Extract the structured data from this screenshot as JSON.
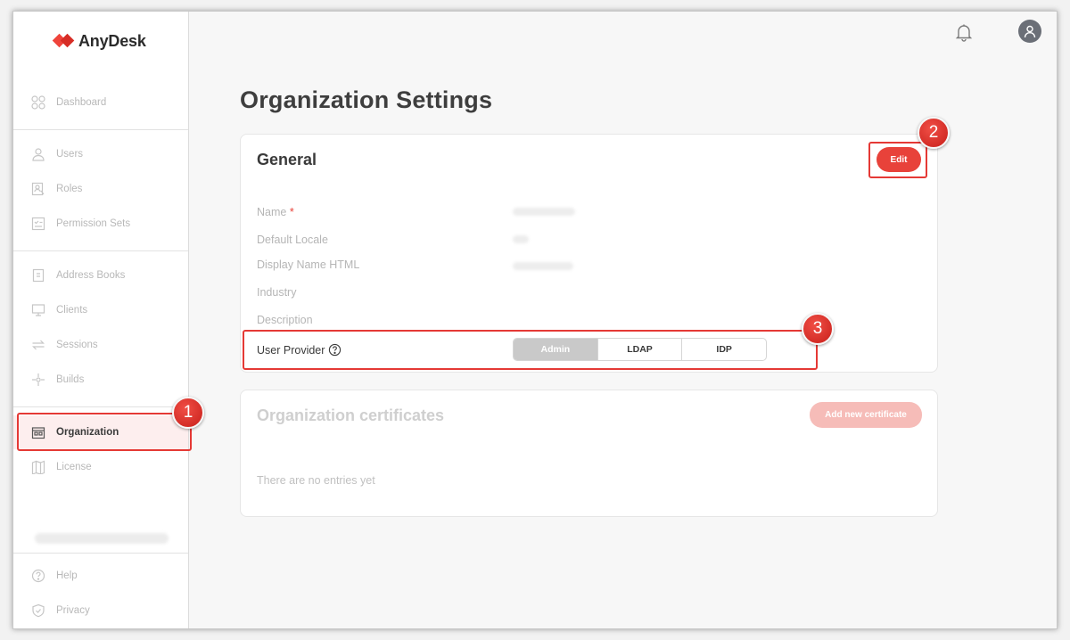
{
  "app": {
    "brand": "AnyDesk"
  },
  "sidebar": {
    "items": [
      {
        "label": "Dashboard",
        "icon": "dashboard-icon"
      },
      {
        "label": "Users",
        "icon": "user-icon"
      },
      {
        "label": "Roles",
        "icon": "roles-icon"
      },
      {
        "label": "Permission Sets",
        "icon": "permission-icon"
      },
      {
        "label": "Address Books",
        "icon": "address-book-icon"
      },
      {
        "label": "Clients",
        "icon": "monitor-icon"
      },
      {
        "label": "Sessions",
        "icon": "arrows-icon"
      },
      {
        "label": "Builds",
        "icon": "builds-icon"
      },
      {
        "label": "Organization",
        "icon": "building-icon",
        "active": true
      },
      {
        "label": "License",
        "icon": "license-icon"
      }
    ],
    "footer": [
      {
        "label": "Help",
        "icon": "help-icon"
      },
      {
        "label": "Privacy",
        "icon": "shield-icon"
      }
    ]
  },
  "header": {
    "bell_icon": "bell-icon",
    "avatar_icon": "avatar-icon"
  },
  "main": {
    "title": "Organization Settings",
    "general": {
      "title": "General",
      "edit_label": "Edit",
      "fields": {
        "name": "Name",
        "name_required": "*",
        "default_locale": "Default Locale",
        "display_name_html": "Display Name HTML",
        "industry": "Industry",
        "description": "Description",
        "user_provider": "User Provider"
      },
      "provider_options": [
        "Admin",
        "LDAP",
        "IDP"
      ],
      "provider_selected": "Admin"
    },
    "certificates": {
      "title": "Organization certificates",
      "add_label": "Add new certificate",
      "empty_text": "There are no entries yet"
    }
  },
  "annotations": {
    "badge1": "1",
    "badge2": "2",
    "badge3": "3"
  },
  "colors": {
    "accent": "#e8423a",
    "highlight": "#e53935"
  }
}
